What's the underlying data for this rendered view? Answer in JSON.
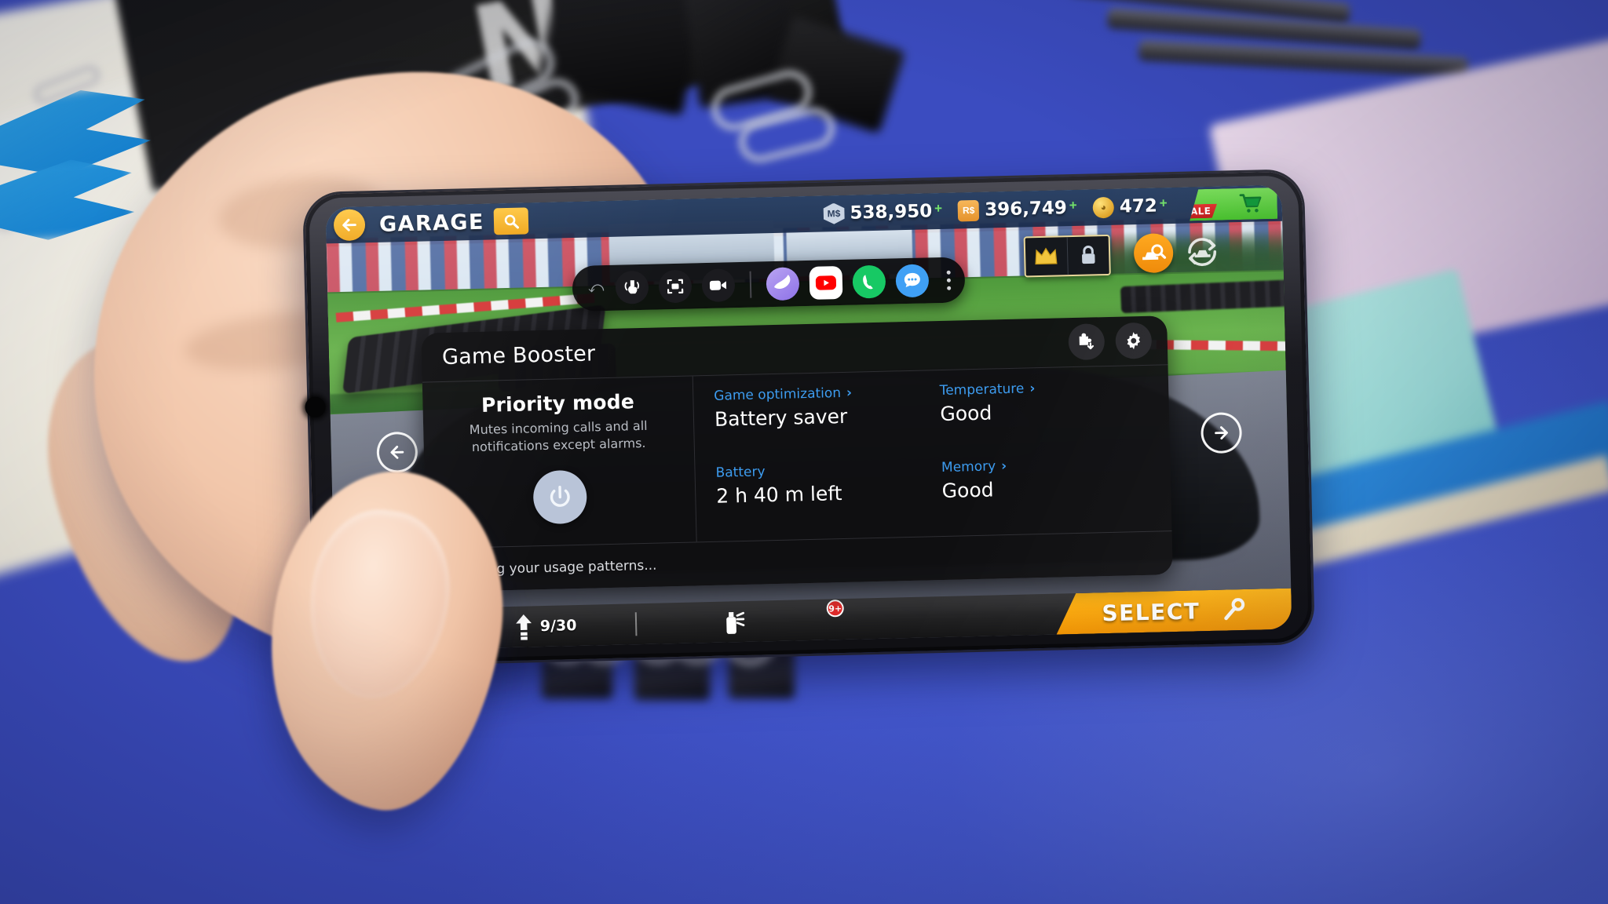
{
  "game": {
    "title": "GARAGE",
    "back_icon": "arrow-left-icon",
    "search_icon": "search-icon",
    "currencies": [
      {
        "badge": "MS",
        "badge_kind": "ms-token",
        "value": "538,950",
        "plus": "+"
      },
      {
        "badge": "RS",
        "badge_kind": "rs-token",
        "value": "396,749",
        "plus": "+"
      },
      {
        "badge": "",
        "badge_kind": "gold-coin",
        "value": "472",
        "plus": "+"
      }
    ],
    "shop": {
      "sale_label": "SALE",
      "cart_icon": "shopping-cart-icon"
    },
    "vip_badge": {
      "crown_icon": "crown-icon",
      "lock_icon": "padlock-icon"
    },
    "buttons": {
      "car_search_icon": "car-search-icon",
      "car_rotate_icon": "car-rotate-icon",
      "prev_icon": "arrow-left-circle-icon",
      "next_icon": "arrow-right-circle-icon"
    },
    "bottom_bar": {
      "oil_icon": "oil-can-icon",
      "upgrade_icon": "upgrade-arrow-icon",
      "upgrade_count": "9/30",
      "paint_icon": "spray-paint-icon",
      "paint_badge": "9+",
      "select_label": "SELECT",
      "wrench_icon": "wrench-icon"
    }
  },
  "floating_toolbar": {
    "handle_icon": "drag-handle-icon",
    "tools": [
      {
        "name": "touch-lock-icon",
        "label": "Touch protection"
      },
      {
        "name": "screenshot-icon",
        "label": "Screenshot"
      },
      {
        "name": "record-video-icon",
        "label": "Record"
      }
    ],
    "apps": [
      {
        "name": "samsung-internet-icon",
        "label": "Internet"
      },
      {
        "name": "youtube-icon",
        "label": "YouTube"
      },
      {
        "name": "phone-icon",
        "label": "Phone"
      },
      {
        "name": "messages-icon",
        "label": "Messages"
      }
    ],
    "overflow_icon": "more-vertical-icon"
  },
  "game_booster": {
    "title": "Game Booster",
    "header_actions": [
      {
        "name": "plugin-download-icon",
        "label": "Plugins"
      },
      {
        "name": "gear-icon",
        "label": "Settings"
      }
    ],
    "priority_mode": {
      "title": "Priority mode",
      "description": "Mutes incoming calls and all notifications except alarms.",
      "toggle_icon": "power-icon",
      "toggle_state": "off"
    },
    "stats": [
      {
        "label": "Game optimization",
        "value": "Battery saver",
        "chevron": "›",
        "name": "game-optimization"
      },
      {
        "label": "Temperature",
        "value": "Good",
        "chevron": "›",
        "name": "temperature"
      },
      {
        "label": "Battery",
        "value": "2 h 40 m left",
        "chevron": "",
        "name": "battery"
      },
      {
        "label": "Memory",
        "value": "Good",
        "chevron": "›",
        "name": "memory"
      }
    ],
    "footer_text": "Learning your usage patterns...",
    "accent_color": "#3d9cf0",
    "panel_color": "#101012"
  }
}
